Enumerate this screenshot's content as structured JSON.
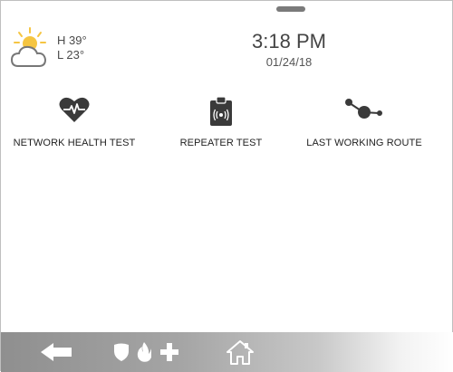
{
  "weather": {
    "icon": "partly-cloudy-icon",
    "high": "H 39°",
    "low": "L 23°"
  },
  "clock": {
    "time": "3:18 PM",
    "date": "01/24/18"
  },
  "tools": [
    {
      "icon": "heart-pulse-icon",
      "label": "NETWORK HEALTH TEST"
    },
    {
      "icon": "clipboard-signal-icon",
      "label": "REPEATER TEST"
    },
    {
      "icon": "route-nodes-icon",
      "label": "LAST WORKING ROUTE"
    }
  ],
  "bottom_bar": {
    "buttons": [
      {
        "icon": "back-arrow-icon"
      },
      {
        "icon": "shield-icon"
      },
      {
        "icon": "fire-icon"
      },
      {
        "icon": "medical-cross-icon"
      },
      {
        "icon": "home-icon"
      }
    ]
  },
  "colors": {
    "icon_dark": "#3a3a3a",
    "sun": "#f5c542",
    "bar_left": "#8f8f8f",
    "bar_right": "#ffffff"
  }
}
